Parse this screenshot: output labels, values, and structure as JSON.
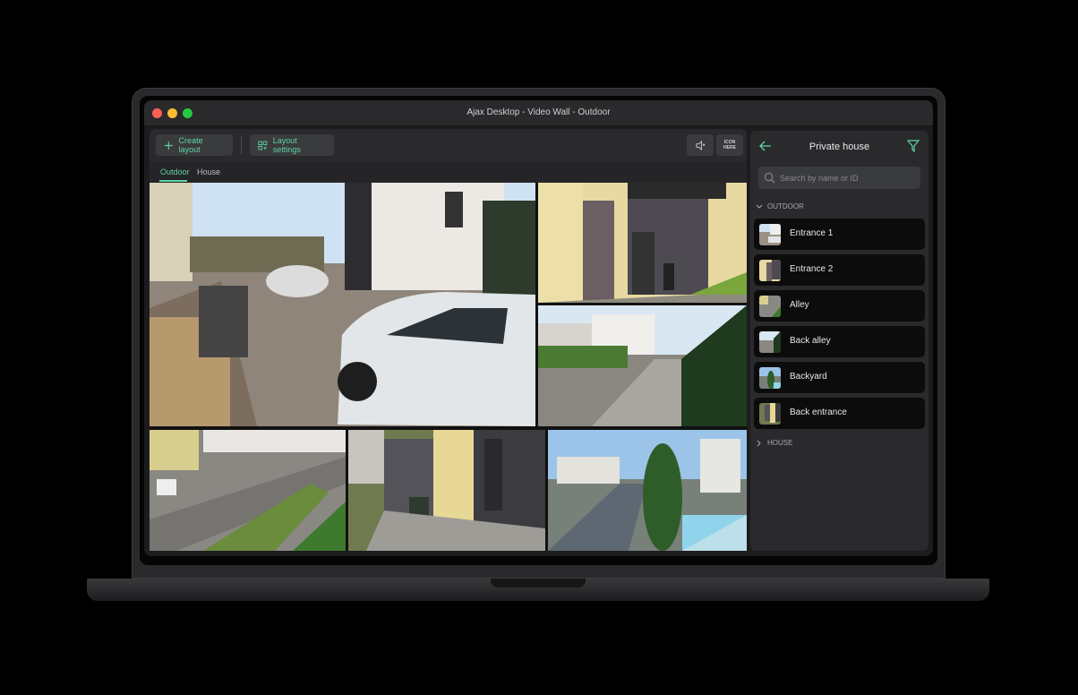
{
  "window": {
    "title": "Ajax Desktop - Video Wall - Outdoor"
  },
  "toolbar": {
    "create_layout": "Create layout",
    "layout_settings": "Layout settings",
    "sound_icon": "speaker-icon",
    "icon_label_line1": "ICON",
    "icon_label_line2": "HERE"
  },
  "tabs": [
    {
      "label": "Outdoor",
      "active": true
    },
    {
      "label": "House",
      "active": false
    }
  ],
  "panel": {
    "title": "Private house",
    "search_placeholder": "Search by name or ID",
    "groups": [
      {
        "label": "OUTDOOR",
        "expanded": true
      },
      {
        "label": "HOUSE",
        "expanded": false
      }
    ],
    "cameras": [
      {
        "name": "Entrance 1"
      },
      {
        "name": "Entrance 2"
      },
      {
        "name": "Alley"
      },
      {
        "name": "Back alley"
      },
      {
        "name": "Backyard"
      },
      {
        "name": "Back entrance"
      }
    ]
  },
  "colors": {
    "accent": "#5fd3a6",
    "panel": "#2a2a2d",
    "item": "#0c0c0d"
  }
}
